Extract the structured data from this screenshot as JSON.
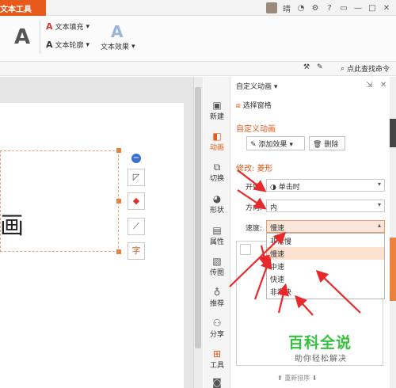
{
  "window": {
    "context_tab": "文本工具",
    "controls": [
      "晴",
      "?",
      "▭",
      "—",
      "□",
      "✕"
    ]
  },
  "ribbon": {
    "text_fill": "文本填充",
    "text_outline": "文本轮廓",
    "text_effect": "文本效果",
    "find_command": "点此查找命令"
  },
  "slide": {
    "glyph": "画"
  },
  "sidebar": {
    "items": [
      {
        "label": "新建",
        "icon": "new-icon"
      },
      {
        "label": "动画",
        "icon": "animation-icon"
      },
      {
        "label": "切换",
        "icon": "transition-icon"
      },
      {
        "label": "形状",
        "icon": "shapes-icon"
      },
      {
        "label": "属性",
        "icon": "properties-icon"
      },
      {
        "label": "传图",
        "icon": "upload-image-icon"
      },
      {
        "label": "推荐",
        "icon": "recommend-icon"
      },
      {
        "label": "分享",
        "icon": "share-icon"
      },
      {
        "label": "工具",
        "icon": "tools-icon"
      }
    ],
    "active": "动画"
  },
  "pane": {
    "title": "自定义动画",
    "select_pane": "选择窗格",
    "section_title": "自定义动画",
    "add_effect": "添加效果",
    "delete": "删除",
    "modify_title": "修改: 菱形",
    "start_label": "开始:",
    "start_value": "单击时",
    "direction_label": "方向:",
    "direction_value": "内",
    "speed_label": "速度:",
    "speed_value": "慢速",
    "speed_options": [
      "非常慢",
      "慢速",
      "中速",
      "快速",
      "非常快"
    ],
    "highlighted_option": "慢速",
    "reorder": "重新排序"
  },
  "watermark": {
    "title": "百科全说",
    "subtitle": "助你轻松解决"
  },
  "colors": {
    "accent": "#e25a1b",
    "arrow": "#e8292b",
    "watermark": "#33c23d"
  }
}
